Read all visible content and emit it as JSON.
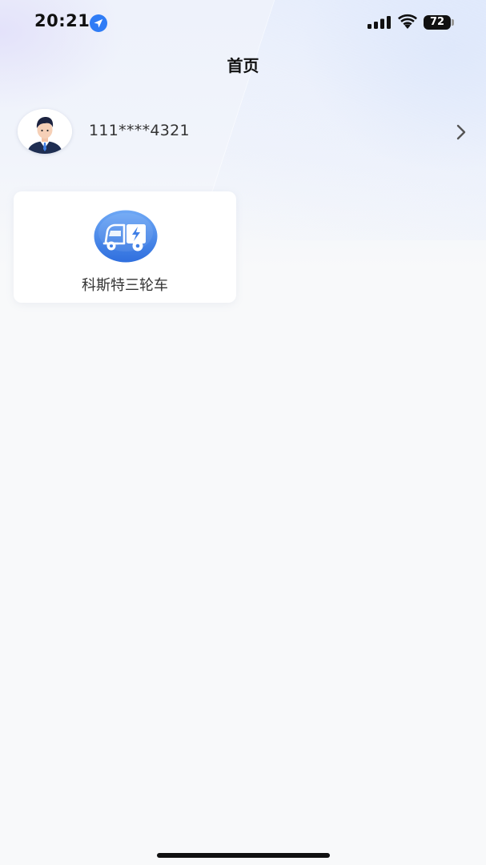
{
  "status_bar": {
    "time": "20:21",
    "battery": "72",
    "icons": [
      "location-arrow-icon",
      "signal-bars-icon",
      "wifi-icon",
      "battery-icon"
    ]
  },
  "header": {
    "title": "首页"
  },
  "profile": {
    "phone": "111****4321",
    "avatar_icon": "user-avatar",
    "chevron_icon": "chevron-right-icon"
  },
  "devices": [
    {
      "label": "科斯特三轮车",
      "icon": "electric-tricycle-icon",
      "icon_color": "#3f7fe6"
    }
  ],
  "colors": {
    "accent": "#3f7fe6",
    "background": "#f8f9fa"
  }
}
